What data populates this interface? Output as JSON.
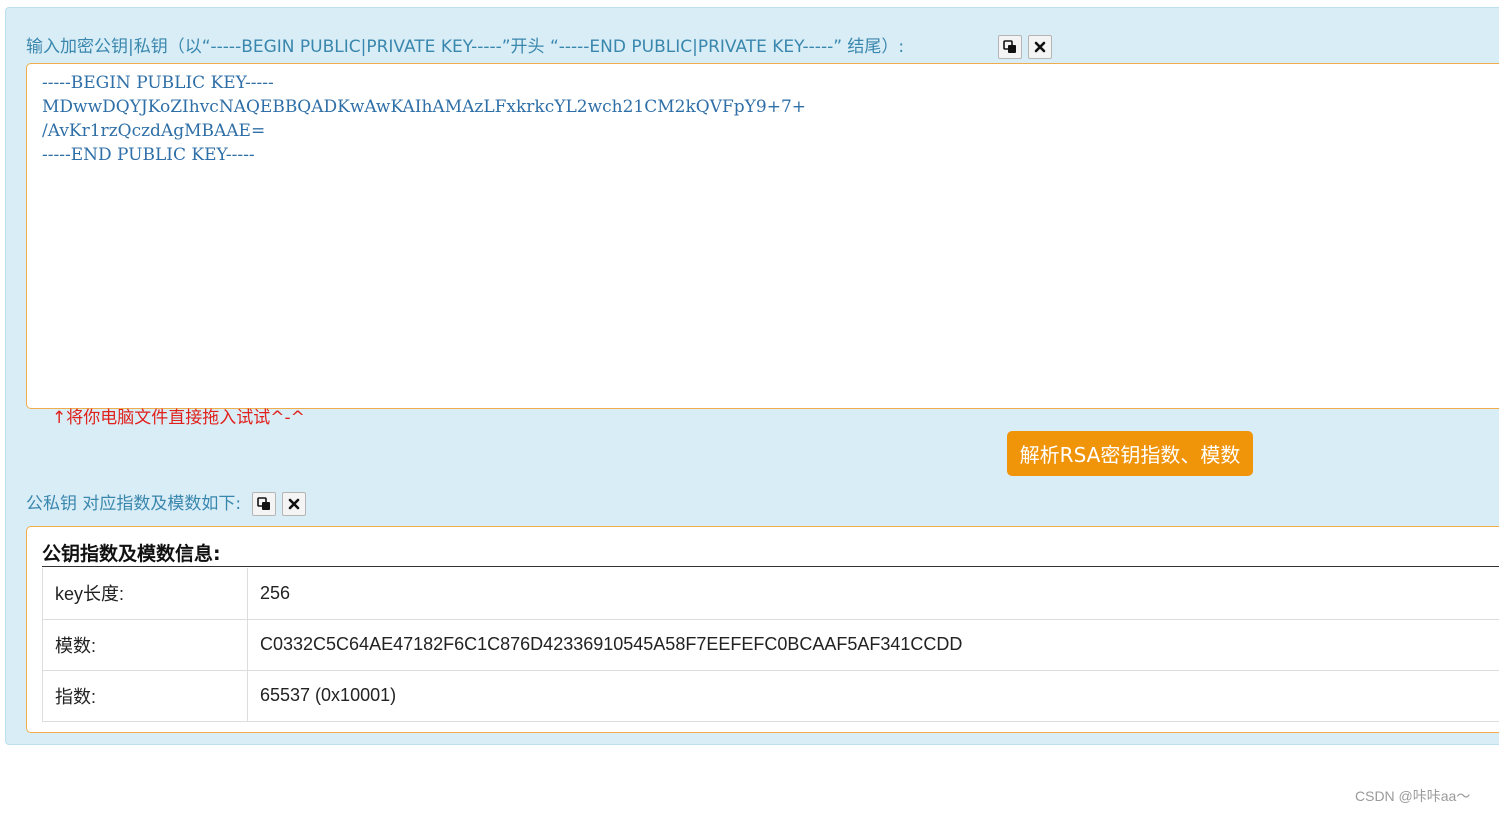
{
  "input_section": {
    "label": "输入加密公钥|私钥（以“-----BEGIN PUBLIC|PRIVATE KEY-----”开头 “-----END PUBLIC|PRIVATE KEY-----” 结尾）:",
    "copy_icon": "copy-icon",
    "clear_icon": "close-icon",
    "key_text": "-----BEGIN PUBLIC KEY-----\nMDwwDQYJKoZIhvcNAQEBBQADKwAwKAIhAMAzLFxkrkcYL2wch21CM2kQVFpY9+7+\n/AvKr1rzQczdAgMBAAE=\n-----END PUBLIC KEY-----",
    "drag_hint": "↑将你电脑文件直接拖入试试^-^"
  },
  "parse_button_label": "解析RSA密钥指数、模数",
  "result_section": {
    "label": "公私钥 对应指数及模数如下:",
    "copy_icon": "copy-icon",
    "clear_icon": "close-icon",
    "title": "公钥指数及模数信息:",
    "rows": [
      {
        "key": "key长度:",
        "value": "256"
      },
      {
        "key": "模数:",
        "value": "C0332C5C64AE47182F6C1C876D42336910545A58F7EEFEFC0BCAAF5AF341CCDD"
      },
      {
        "key": "指数:",
        "value": "65537 (0x10001)"
      }
    ]
  },
  "watermark": "CSDN @咔咔aa～",
  "colors": {
    "panel_bg": "#d9edf7",
    "label_text": "#3a87ad",
    "accent_border": "#f0ad4e",
    "button_bg": "#f0940a",
    "hint_red": "#e0211b"
  }
}
